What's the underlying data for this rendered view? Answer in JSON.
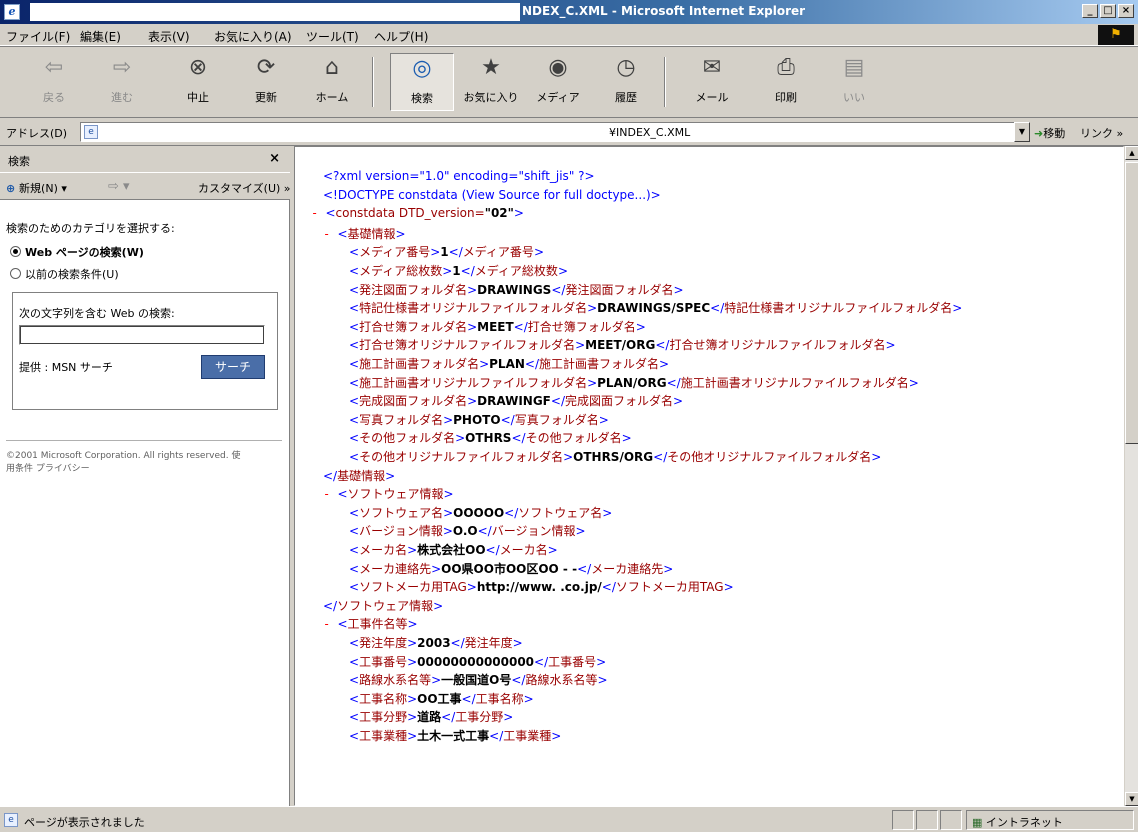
{
  "window": {
    "title_suffix": "NDEX_C.XML - Microsoft Internet Explorer",
    "buttons": [
      "_",
      "□",
      "×"
    ]
  },
  "menu": {
    "items": [
      "ファイル(F)",
      "編集(E)",
      "表示(V)",
      "お気に入り(A)",
      "ツール(T)",
      "ヘルプ(H)"
    ]
  },
  "toolbar": {
    "buttons": [
      {
        "label": "戻る",
        "icon": "back-icon",
        "glyph": "⇦",
        "disabled": true
      },
      {
        "label": "進む",
        "icon": "forward-icon",
        "glyph": "⇨",
        "disabled": true
      },
      {
        "label": "中止",
        "icon": "stop-icon",
        "glyph": "⊗",
        "disabled": false
      },
      {
        "label": "更新",
        "icon": "refresh-icon",
        "glyph": "⟳",
        "disabled": false
      },
      {
        "label": "ホーム",
        "icon": "home-icon",
        "glyph": "⌂",
        "disabled": false
      },
      {
        "label": "検索",
        "icon": "search-icon",
        "glyph": "◎",
        "disabled": false,
        "pressed": true
      },
      {
        "label": "お気に入り",
        "icon": "favorites-icon",
        "glyph": "★",
        "disabled": false
      },
      {
        "label": "メディア",
        "icon": "media-icon",
        "glyph": "◉",
        "disabled": false
      },
      {
        "label": "履歴",
        "icon": "history-icon",
        "glyph": "◷",
        "disabled": false
      },
      {
        "label": "メール",
        "icon": "mail-icon",
        "glyph": "✉",
        "disabled": false
      },
      {
        "label": "印刷",
        "icon": "print-icon",
        "glyph": "⎙",
        "disabled": false
      },
      {
        "label": "いい",
        "icon": "edit-icon",
        "glyph": "▤",
        "disabled": true
      }
    ]
  },
  "address": {
    "label": "アドレス(D)",
    "value_visible": "¥INDEX_C.XML",
    "go_label": "移動",
    "links_label": "リンク"
  },
  "search_pane": {
    "title": "検索",
    "close": "×",
    "new_label": "新規(N)",
    "customize_label": "カスタマイズ(U)",
    "heading": "検索のためのカテゴリを選択する:",
    "radio_web": "Web ページの検索(W)",
    "radio_previous": "以前の検索条件(U)",
    "box_label": "次の文字列を含む Web の検索:",
    "query": "",
    "provider": "提供 : MSN サーチ",
    "search_button": "サーチ",
    "copyright": "©2001 Microsoft Corporation. All rights reserved.   使用条件   プライバシー"
  },
  "xml_lines": [
    {
      "indent": 1,
      "kind": "pi",
      "text": "<?xml version=\"1.0\" encoding=\"shift_jis\" ?>"
    },
    {
      "indent": 1,
      "kind": "pi",
      "text": "<!DOCTYPE constdata (View Source for full doctype...)>"
    },
    {
      "indent": 0,
      "kind": "open-attr",
      "dash": "-",
      "tag": "constdata",
      "attr": " DTD_version=",
      "aval": "\"02\"",
      "close": ">"
    },
    {
      "indent": 1,
      "kind": "open",
      "dash": "-",
      "tag": "基礎情報"
    },
    {
      "indent": 2,
      "kind": "elem",
      "tag": "メディア番号",
      "text": "1"
    },
    {
      "indent": 2,
      "kind": "elem",
      "tag": "メディア総枚数",
      "text": "1"
    },
    {
      "indent": 2,
      "kind": "elem",
      "tag": "発注図面フォルダ名",
      "text": "DRAWINGS"
    },
    {
      "indent": 2,
      "kind": "elem",
      "tag": "特記仕様書オリジナルファイルフォルダ名",
      "text": "DRAWINGS/SPEC"
    },
    {
      "indent": 2,
      "kind": "elem",
      "tag": "打合せ簿フォルダ名",
      "text": "MEET"
    },
    {
      "indent": 2,
      "kind": "elem",
      "tag": "打合せ簿オリジナルファイルフォルダ名",
      "text": "MEET/ORG"
    },
    {
      "indent": 2,
      "kind": "elem",
      "tag": "施工計画書フォルダ名",
      "text": "PLAN"
    },
    {
      "indent": 2,
      "kind": "elem",
      "tag": "施工計画書オリジナルファイルフォルダ名",
      "text": "PLAN/ORG"
    },
    {
      "indent": 2,
      "kind": "elem",
      "tag": "完成図面フォルダ名",
      "text": "DRAWINGF"
    },
    {
      "indent": 2,
      "kind": "elem",
      "tag": "写真フォルダ名",
      "text": "PHOTO"
    },
    {
      "indent": 2,
      "kind": "elem",
      "tag": "その他フォルダ名",
      "text": "OTHRS"
    },
    {
      "indent": 2,
      "kind": "elem",
      "tag": "その他オリジナルファイルフォルダ名",
      "text": "OTHRS/ORG"
    },
    {
      "indent": 1,
      "kind": "close",
      "tag": "基礎情報"
    },
    {
      "indent": 1,
      "kind": "open",
      "dash": "-",
      "tag": "ソフトウェア情報"
    },
    {
      "indent": 2,
      "kind": "elem",
      "tag": "ソフトウェア名",
      "text": "OOOOO"
    },
    {
      "indent": 2,
      "kind": "elem",
      "tag": "バージョン情報",
      "text": "O.O"
    },
    {
      "indent": 2,
      "kind": "elem",
      "tag": "メーカ名",
      "text": "株式会社OO"
    },
    {
      "indent": 2,
      "kind": "elem",
      "tag": "メーカ連絡先",
      "text": "OO県OO市OO区OO - -"
    },
    {
      "indent": 2,
      "kind": "elem",
      "tag": "ソフトメーカ用TAG",
      "text": "http://www. .co.jp/"
    },
    {
      "indent": 1,
      "kind": "close",
      "tag": "ソフトウェア情報"
    },
    {
      "indent": 1,
      "kind": "open",
      "dash": "-",
      "tag": "工事件名等"
    },
    {
      "indent": 2,
      "kind": "elem",
      "tag": "発注年度",
      "text": "2003"
    },
    {
      "indent": 2,
      "kind": "elem",
      "tag": "工事番号",
      "text": "00000000000000"
    },
    {
      "indent": 2,
      "kind": "elem",
      "tag": "路線水系名等",
      "text": "一般国道O号"
    },
    {
      "indent": 2,
      "kind": "elem",
      "tag": "工事名称",
      "text": "OO工事"
    },
    {
      "indent": 2,
      "kind": "elem",
      "tag": "工事分野",
      "text": "道路"
    },
    {
      "indent": 2,
      "kind": "elem",
      "tag": "工事業種",
      "text": "土木一式工事"
    }
  ],
  "status": {
    "text": "ページが表示されました",
    "zone": "イントラネット"
  }
}
